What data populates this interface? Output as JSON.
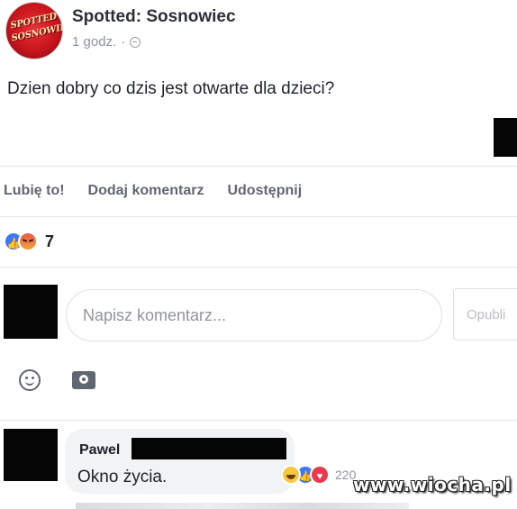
{
  "post": {
    "page_name": "Spotted: Sosnowiec",
    "avatar_text": "SPOTTED SOSNOWIEC",
    "time": "1 godz.",
    "separator": "·",
    "text": "Dzien dobry co dzis jest otwarte dla dzieci?"
  },
  "actions": {
    "like": "Lubię to!",
    "comment": "Dodaj komentarz",
    "share": "Udostępnij"
  },
  "reactions": {
    "count": "7",
    "icons": [
      "like-icon",
      "angry-icon"
    ]
  },
  "composer": {
    "placeholder": "Napisz komentarz...",
    "publish_label": "Opubli"
  },
  "comment": {
    "author": "Pawel",
    "text": "Okno życia.",
    "reaction_count": "220",
    "reaction_icons": [
      "haha-icon",
      "like-icon",
      "love-icon"
    ]
  },
  "watermark": "www.wiocha.pl"
}
